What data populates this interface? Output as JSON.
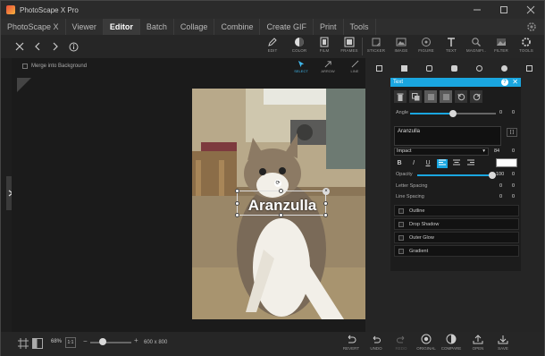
{
  "window": {
    "title": "PhotoScape X Pro",
    "controls": [
      "minimize-icon",
      "maximize-icon",
      "close-icon"
    ]
  },
  "menu": {
    "items": [
      "PhotoScape X",
      "Viewer",
      "Editor",
      "Batch",
      "Collage",
      "Combine",
      "Create GIF",
      "Print",
      "Tools"
    ],
    "active": "Editor"
  },
  "toolbar": {
    "tools": [
      {
        "label": "EDIT",
        "icon": "pencil-icon"
      },
      {
        "label": "COLOR",
        "icon": "color-icon"
      },
      {
        "label": "FILM",
        "icon": "film-icon"
      },
      {
        "label": "FRAMES",
        "icon": "frames-icon"
      },
      {
        "label": "STICKER",
        "icon": "sticker-icon"
      },
      {
        "label": "IMAGE",
        "icon": "image-icon"
      },
      {
        "label": "FIGURE",
        "icon": "figure-icon"
      },
      {
        "label": "TEXT",
        "icon": "text-icon"
      },
      {
        "label": "MAGNIFI..",
        "icon": "magnifier-icon"
      },
      {
        "label": "FILTER",
        "icon": "filter-icon"
      },
      {
        "label": "TOOLS",
        "icon": "tools-icon"
      }
    ]
  },
  "canvas": {
    "merge_label": "Merge into Background",
    "subtools": [
      {
        "label": "SELECT",
        "icon": "select-icon"
      },
      {
        "label": "ARROW",
        "icon": "arrow-icon"
      },
      {
        "label": "LINE",
        "icon": "line-icon"
      }
    ],
    "text_overlay": "Aranzulla"
  },
  "text_panel": {
    "title": "Text",
    "angle_label": "Angle",
    "angle_value": "0",
    "angle_value2": "0",
    "angle_fraction": 0.5,
    "text_value": "Aranzulla",
    "font": "Impact",
    "font_size": "84",
    "font_size2": "0",
    "format_buttons": [
      "B",
      "I",
      "U"
    ],
    "text_color": "#ffffff",
    "opacity_label": "Opacity",
    "opacity_value": "100",
    "opacity_value2": "0",
    "opacity_fraction": 1.0,
    "letter_spacing_label": "Letter Spacing",
    "letter_spacing_value": "0",
    "letter_spacing_value2": "0",
    "line_spacing_label": "Line Spacing",
    "line_spacing_value": "0",
    "line_spacing_value2": "0",
    "effects": [
      "Outline",
      "Drop Shadow",
      "Outer Glow",
      "Gradient"
    ]
  },
  "bottom": {
    "zoom": "68%",
    "zoom_box": "1:1",
    "zoom_fraction": 0.3,
    "image_size": "600 x 800",
    "tools": [
      {
        "label": "REVERT",
        "icon": "revert-icon"
      },
      {
        "label": "UNDO",
        "icon": "undo-icon"
      },
      {
        "label": "REDO",
        "icon": "redo-icon"
      },
      {
        "label": "ORIGINAL",
        "icon": "original-icon"
      },
      {
        "label": "COMPARE",
        "icon": "compare-icon"
      },
      {
        "label": "OPEN",
        "icon": "open-icon"
      },
      {
        "label": "SAVE",
        "icon": "save-icon"
      }
    ]
  },
  "colors": {
    "accent": "#1aa6e0",
    "background": "#222222"
  }
}
